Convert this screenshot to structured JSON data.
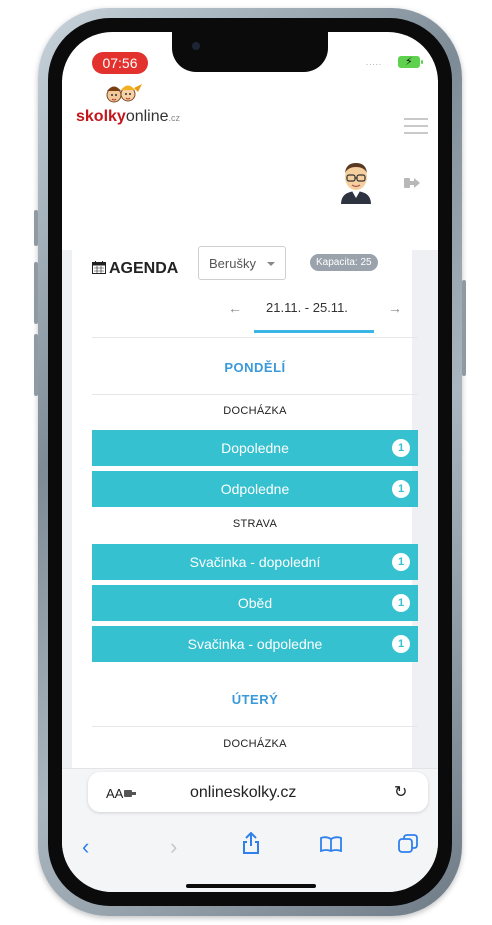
{
  "status_bar": {
    "time": "07:56",
    "signal": "....."
  },
  "header": {
    "logo": {
      "part1": "skolky",
      "part2": "online",
      "part3": ".cz"
    },
    "menu_icon": "hamburger-icon",
    "avatar_icon": "user-avatar",
    "logout_icon": "sign-out-icon"
  },
  "agenda": {
    "title": "AGENDA",
    "group_select": {
      "value": "Berušky"
    },
    "capacity_badge": "Kapacita: 25",
    "week": {
      "label": "21.11. - 25.11.",
      "prev_icon": "arrow-left-icon",
      "next_icon": "arrow-right-icon"
    }
  },
  "days": [
    {
      "name": "PONDĚLÍ",
      "sections": [
        {
          "title": "DOCHÁZKA",
          "items": [
            {
              "label": "Dopoledne",
              "count": "1"
            },
            {
              "label": "Odpoledne",
              "count": "1"
            }
          ]
        },
        {
          "title": "STRAVA",
          "items": [
            {
              "label": "Svačinka - dopolední",
              "count": "1"
            },
            {
              "label": "Oběd",
              "count": "1"
            },
            {
              "label": "Svačinka - odpoledne",
              "count": "1"
            }
          ]
        }
      ]
    },
    {
      "name": "ÚTERÝ",
      "sections": [
        {
          "title": "DOCHÁZKA",
          "items": []
        }
      ]
    }
  ],
  "browser": {
    "aa_label": "AA",
    "url": "onlineskolky.cz",
    "reload_icon": "reload-icon",
    "nav_icons": [
      "back-icon",
      "forward-icon",
      "share-icon",
      "bookmarks-icon",
      "tabs-icon"
    ]
  },
  "colors": {
    "accent": "#35c1cf",
    "day_heading": "#3a9ad9",
    "tab_underline": "#3ab5e5",
    "time_pill": "#e3322e",
    "logo_red": "#c3171b"
  }
}
